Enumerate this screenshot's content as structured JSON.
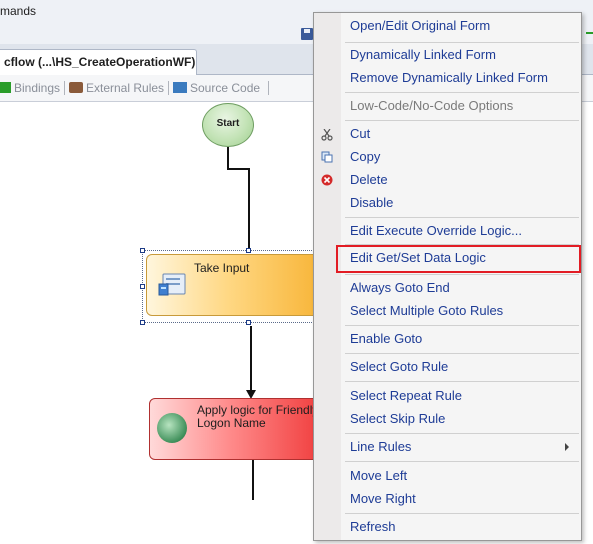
{
  "top": {
    "commands_label": "mands"
  },
  "document_tab": {
    "label": "cflow (...\\HS_CreateOperationWF)"
  },
  "designer_tabs": [
    {
      "label": "Bindings",
      "icon": "bindings-icon"
    },
    {
      "label": "External Rules",
      "icon": "external-rules-icon"
    },
    {
      "label": "Source Code",
      "icon": "source-code-icon"
    }
  ],
  "canvas": {
    "start_label": "Start",
    "take_input_label": "Take Input",
    "apply_logic_label": "Apply logic for Friendly\nLogon Name"
  },
  "context_menu": {
    "items": [
      {
        "label": "Open/Edit Original Form"
      },
      {
        "label": "Dynamically Linked Form"
      },
      {
        "label": "Remove Dynamically Linked Form"
      },
      {
        "label": "Low-Code/No-Code Options",
        "disabled": true
      },
      {
        "label": "Cut",
        "icon": "scissors-icon"
      },
      {
        "label": "Copy",
        "icon": "copy-icon"
      },
      {
        "label": "Delete",
        "icon": "delete-icon"
      },
      {
        "label": "Disable"
      },
      {
        "label": "Edit Execute Override Logic..."
      },
      {
        "label": "Edit Get/Set Data Logic",
        "highlighted": true
      },
      {
        "label": "Always Goto End"
      },
      {
        "label": "Select Multiple Goto Rules"
      },
      {
        "label": "Enable Goto"
      },
      {
        "label": "Select Goto Rule"
      },
      {
        "label": "Select Repeat Rule"
      },
      {
        "label": "Select Skip Rule"
      },
      {
        "label": "Line Rules",
        "submenu": true
      },
      {
        "label": "Move Left"
      },
      {
        "label": "Move Right"
      },
      {
        "label": "Refresh"
      }
    ]
  },
  "colors": {
    "highlight_border": "#e21c24",
    "menu_text": "#1e3c96"
  }
}
